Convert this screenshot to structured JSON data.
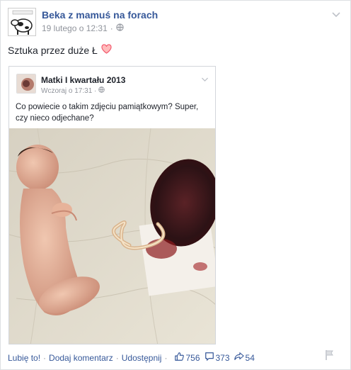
{
  "post": {
    "page_name": "Beka z mamuś na forach",
    "timestamp": "19 lutego o 12:31",
    "separator": "·",
    "text": "Sztuka przez duże Ł"
  },
  "shared_post": {
    "author": "Matki I kwartału 2013",
    "timestamp": "Wczoraj o 17:31",
    "separator": "·",
    "text": "Co powiecie o takim zdjęciu pamiątkowym?  Super, czy nieco odjechane?"
  },
  "actions": {
    "like": "Lubię to!",
    "comment": "Dodaj komentarz",
    "share": "Udostępnij",
    "sep": "·",
    "likes_count": "756",
    "comments_count": "373",
    "shares_count": "54"
  },
  "colors": {
    "link": "#365899",
    "meta": "#90949c",
    "heart": "#f25268"
  },
  "icons": {
    "audience": "globe-icon",
    "options": "chevron-down-icon",
    "like": "thumbs-up-icon",
    "comment": "comment-icon",
    "share": "share-icon",
    "report": "flag-icon"
  }
}
